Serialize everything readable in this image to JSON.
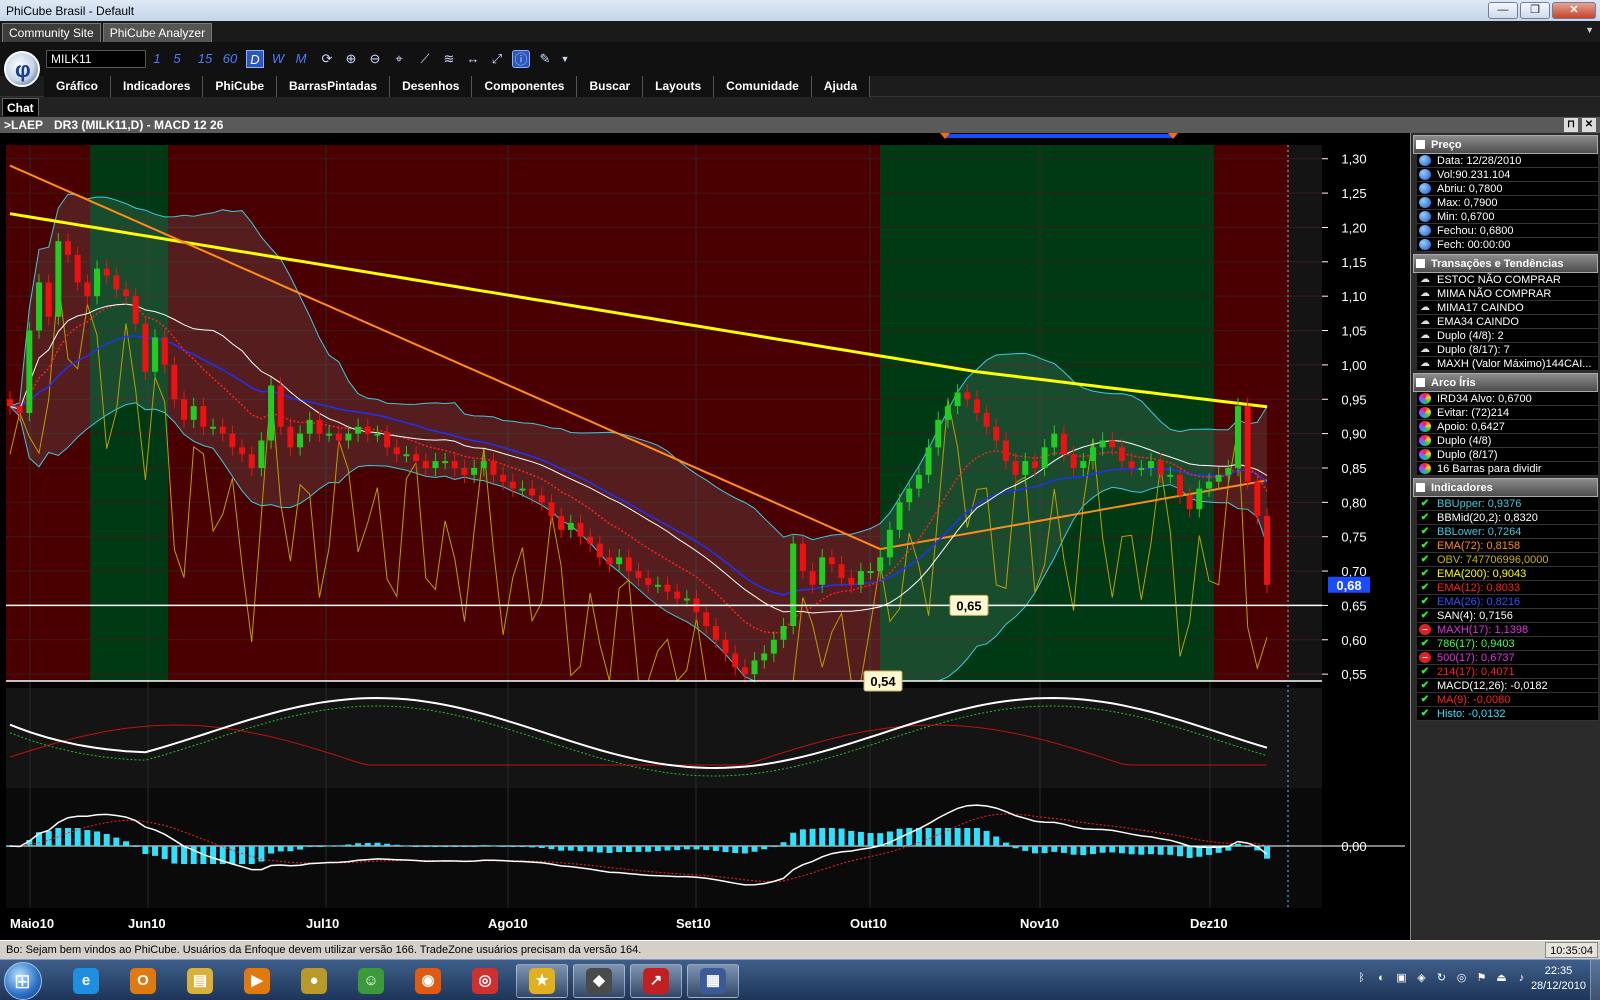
{
  "window": {
    "title": "PhiCube Brasil - Default",
    "minimize": "—",
    "restore": "❐",
    "close": "✕"
  },
  "tabs": [
    "Community Site",
    "PhiCube Analyzer"
  ],
  "toolbar": {
    "symbol": "MILK11",
    "periods": [
      "1",
      "5",
      "15",
      "60",
      "D",
      "W",
      "M"
    ],
    "active_period": "D",
    "icons": [
      "refresh-icon",
      "zoom-in-icon",
      "zoom-out-icon",
      "pin-icon",
      "trend-line-icon",
      "fib-icon",
      "horizontal-line-icon",
      "diagonal-line-icon",
      "info-icon",
      "edit-icon"
    ]
  },
  "menu": [
    "Gráfico",
    "Indicadores",
    "PhiCube",
    "BarrasPintadas",
    "Desenhos",
    "Componentes",
    "Buscar",
    "Layouts",
    "Comunidade",
    "Ajuda"
  ],
  "chat": {
    "label": "Chat"
  },
  "chart_header": {
    "left": ">LAEP",
    "title": "DR3 (MILK11,D) - MACD 12 26"
  },
  "chart_data": {
    "type": "candlestick",
    "price_axis": {
      "ticks": [
        1.3,
        1.25,
        1.2,
        1.15,
        1.1,
        1.05,
        1.0,
        0.95,
        0.9,
        0.85,
        0.8,
        0.75,
        0.7,
        0.65,
        0.6,
        0.55
      ],
      "tick_labels": [
        "1,30",
        "1,25",
        "1,20",
        "1,15",
        "1,10",
        "1,05",
        "1,00",
        "0,95",
        "0,90",
        "0,85",
        "0,80",
        "0,75",
        "0,70",
        "0,65",
        "0,60",
        "0,55"
      ],
      "ylim": [
        0.54,
        1.32
      ]
    },
    "current_price": {
      "value": 0.68,
      "label": "0,68"
    },
    "support_lines": [
      {
        "value": 0.65,
        "label": "0,65"
      },
      {
        "value": 0.54,
        "label": "0,54"
      }
    ],
    "x_labels": [
      "Maio10",
      "Jun10",
      "Jul10",
      "Ago10",
      "Set10",
      "Out10",
      "Nov10",
      "Dez10"
    ],
    "closes": [
      0.94,
      0.93,
      1.05,
      1.12,
      1.07,
      1.18,
      1.16,
      1.12,
      1.1,
      1.14,
      1.13,
      1.11,
      1.1,
      1.06,
      0.99,
      1.04,
      1.0,
      0.95,
      0.92,
      0.94,
      0.91,
      0.91,
      0.9,
      0.88,
      0.87,
      0.85,
      0.89,
      0.97,
      0.91,
      0.88,
      0.9,
      0.92,
      0.9,
      0.9,
      0.89,
      0.9,
      0.91,
      0.9,
      0.9,
      0.88,
      0.87,
      0.87,
      0.86,
      0.85,
      0.86,
      0.86,
      0.85,
      0.84,
      0.85,
      0.86,
      0.84,
      0.83,
      0.82,
      0.82,
      0.81,
      0.8,
      0.78,
      0.76,
      0.77,
      0.75,
      0.74,
      0.72,
      0.71,
      0.72,
      0.7,
      0.69,
      0.68,
      0.68,
      0.67,
      0.66,
      0.66,
      0.64,
      0.62,
      0.6,
      0.58,
      0.56,
      0.55,
      0.57,
      0.58,
      0.6,
      0.62,
      0.74,
      0.7,
      0.68,
      0.72,
      0.71,
      0.69,
      0.68,
      0.7,
      0.7,
      0.72,
      0.76,
      0.8,
      0.82,
      0.84,
      0.88,
      0.92,
      0.94,
      0.96,
      0.95,
      0.93,
      0.91,
      0.89,
      0.86,
      0.84,
      0.86,
      0.85,
      0.88,
      0.9,
      0.87,
      0.85,
      0.86,
      0.88,
      0.89,
      0.88,
      0.86,
      0.85,
      0.85,
      0.86,
      0.84,
      0.84,
      0.81,
      0.79,
      0.82,
      0.83,
      0.84,
      0.85,
      0.94,
      0.83,
      0.78,
      0.68
    ],
    "panels": [
      "price",
      "oscillator",
      "macd"
    ],
    "macd_axis": {
      "label": "0,00"
    },
    "bands": [
      "red",
      "green",
      "red",
      "green",
      "red"
    ]
  },
  "side_panel": {
    "sections": [
      {
        "title": "Preço",
        "items": [
          {
            "icon": "dot",
            "text": "Data: 12/28/2010"
          },
          {
            "icon": "dot",
            "text": "Vol:90.231.104"
          },
          {
            "icon": "dot",
            "text": "Abriu: 0,7800"
          },
          {
            "icon": "dot",
            "text": "Max: 0,7900"
          },
          {
            "icon": "dot",
            "text": "Min: 0,6700"
          },
          {
            "icon": "dot",
            "text": "Fechou: 0,6800"
          },
          {
            "icon": "dot",
            "text": "Fech: 00:00:00"
          }
        ]
      },
      {
        "title": "Transações e Tendências",
        "items": [
          {
            "icon": "cloud",
            "text": "ESTOC NÃO COMPRAR"
          },
          {
            "icon": "cloud",
            "text": "MIMA NÃO COMPRAR"
          },
          {
            "icon": "cloud",
            "text": "MIMA17 CAINDO"
          },
          {
            "icon": "cloud",
            "text": "EMA34 CAINDO"
          },
          {
            "icon": "cloud",
            "text": "Duplo (4/8): 2"
          },
          {
            "icon": "cloud",
            "text": "Duplo (8/17): 7"
          },
          {
            "icon": "cloud",
            "text": "MAXH (Valor Máximo)144CAI..."
          }
        ]
      },
      {
        "title": "Arco Íris",
        "items": [
          {
            "icon": "rainbow",
            "text": "IRD34 Alvo: 0,6700"
          },
          {
            "icon": "rainbow",
            "text": "Evitar: (72)214"
          },
          {
            "icon": "rainbow",
            "text": "Apoio: 0,6427"
          },
          {
            "icon": "rainbow",
            "text": "Duplo (4/8)"
          },
          {
            "icon": "rainbow",
            "text": "Duplo (8/17)"
          },
          {
            "icon": "rainbow",
            "text": "16 Barras para dividir"
          }
        ]
      },
      {
        "title": "Indicadores",
        "items": [
          {
            "icon": "check",
            "text": "BBUpper: 0,9376",
            "color": "#3ec8e0"
          },
          {
            "icon": "check",
            "text": "BBMid(20,2): 0,8320",
            "color": "#ffffff"
          },
          {
            "icon": "check",
            "text": "BBLower: 0,7264",
            "color": "#3ec8e0"
          },
          {
            "icon": "check",
            "text": "EMA(72): 0,8158",
            "color": "#ff8c1a"
          },
          {
            "icon": "check",
            "text": "OBV: 747706996,0000",
            "color": "#c8b400"
          },
          {
            "icon": "check",
            "text": "EMA(200): 0,9043",
            "color": "#ffff00"
          },
          {
            "icon": "check",
            "text": "EMA(12): 0,8033",
            "color": "#ff2020"
          },
          {
            "icon": "check",
            "text": "EMA(26): 0,8216",
            "color": "#3050ff"
          },
          {
            "icon": "check",
            "text": "SAN(4): 0,7156",
            "color": "#ffffff"
          },
          {
            "icon": "no",
            "text": "MAXH(17): 1,1398",
            "color": "#e030e0"
          },
          {
            "icon": "check",
            "text": "786(17): 0,9403",
            "color": "#40ff40"
          },
          {
            "icon": "no",
            "text": "500(17): 0,6737",
            "color": "#e030e0"
          },
          {
            "icon": "check",
            "text": "214(17): 0,4071",
            "color": "#ff2020"
          },
          {
            "icon": "check",
            "text": "MACD(12,26): -0,0182",
            "color": "#ffffff"
          },
          {
            "icon": "check",
            "text": "MA(9): -0,0080",
            "color": "#ff2020"
          },
          {
            "icon": "check",
            "text": "Histo: -0,0132",
            "color": "#30e0ff"
          }
        ]
      }
    ]
  },
  "statusbar": {
    "message": "Bo: Sejam bem vindos ao PhiCube.  Usuários da Enfoque devem utilizar versão 166.  TradeZone usuários precisam da versão 164.",
    "clock": "10:35:04"
  },
  "taskbar": {
    "apps": [
      {
        "name": "internet-explorer",
        "glyph": "e",
        "color": "#1e8fe0"
      },
      {
        "name": "outlook",
        "glyph": "O",
        "color": "#e07a10"
      },
      {
        "name": "explorer",
        "glyph": "▤",
        "color": "#d9b13a"
      },
      {
        "name": "media-player",
        "glyph": "▶",
        "color": "#e07a10"
      },
      {
        "name": "app-gold",
        "glyph": "●",
        "color": "#b89a2a"
      },
      {
        "name": "messenger",
        "glyph": "☺",
        "color": "#3a9a3a"
      },
      {
        "name": "firefox",
        "glyph": "◉",
        "color": "#e05a10"
      },
      {
        "name": "chrome",
        "glyph": "◎",
        "color": "#d03030"
      },
      {
        "name": "favorites",
        "glyph": "★",
        "color": "#e0b020",
        "running": true
      },
      {
        "name": "game",
        "glyph": "◆",
        "color": "#4a4a4a",
        "running": true
      },
      {
        "name": "phicube",
        "glyph": "↗",
        "color": "#c02020",
        "running": true
      },
      {
        "name": "document",
        "glyph": "▦",
        "color": "#3a5a9a",
        "running": true
      }
    ],
    "tray_icons": [
      "bluetooth-icon",
      "network-icon",
      "monitor-icon",
      "antivirus-icon",
      "update-icon",
      "chrome-tray-icon",
      "flag-icon",
      "safely-remove-icon",
      "volume-icon"
    ],
    "time": "22:35",
    "date": "28/12/2010"
  }
}
